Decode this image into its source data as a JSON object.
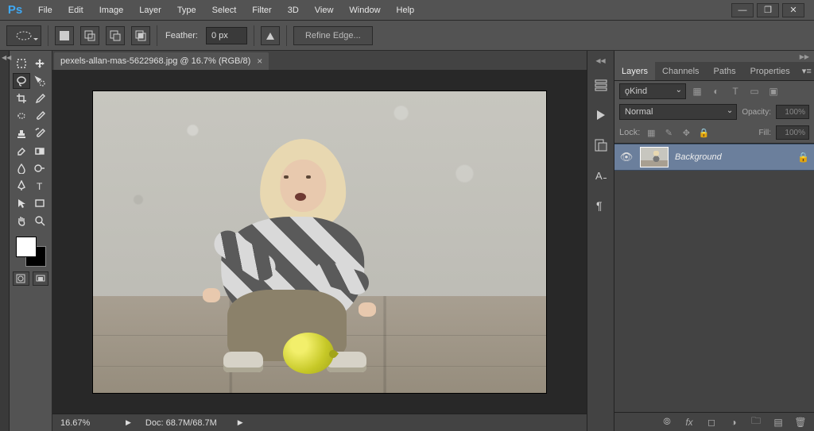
{
  "menu": {
    "items": [
      "File",
      "Edit",
      "Image",
      "Layer",
      "Type",
      "Select",
      "Filter",
      "3D",
      "View",
      "Window",
      "Help"
    ]
  },
  "optbar": {
    "feather_label": "Feather:",
    "feather_value": "0 px",
    "refine_label": "Refine Edge..."
  },
  "document": {
    "tab_title": "pexels-allan-mas-5622968.jpg @ 16.7% (RGB/8)",
    "zoom": "16.67%",
    "doc_size": "Doc: 68.7M/68.7M"
  },
  "layers_panel": {
    "tabs": [
      "Layers",
      "Channels",
      "Paths",
      "Properties"
    ],
    "kind_label": "Kind",
    "blend_mode": "Normal",
    "opacity_label": "Opacity:",
    "opacity_value": "100%",
    "lock_label": "Lock:",
    "fill_label": "Fill:",
    "fill_value": "100%",
    "layer_name": "Background"
  },
  "logo_text": "Ps"
}
